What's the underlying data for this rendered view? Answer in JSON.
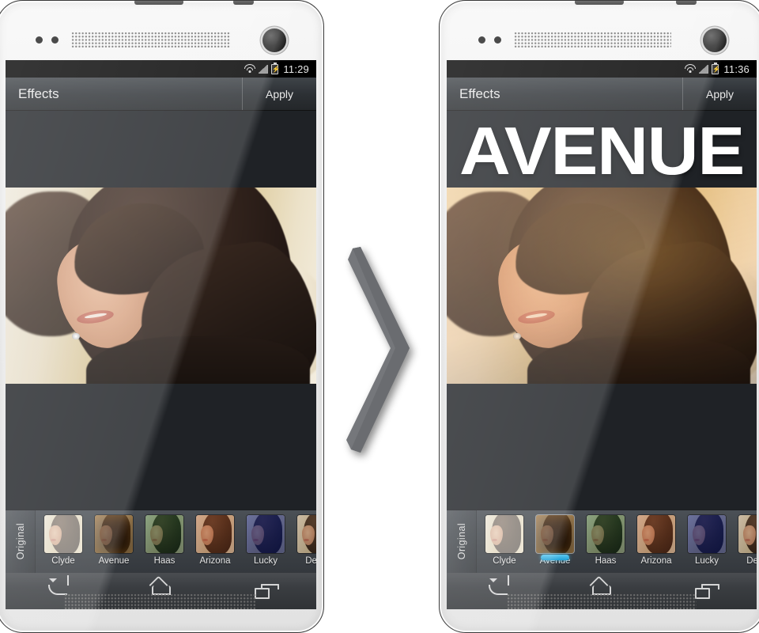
{
  "scene": {
    "description": "Before and after comparison of a photo-filter mobile app on two smartphones",
    "arrow_icon": "chevron-right-icon",
    "arrow_color": "#6f7175"
  },
  "phones": [
    {
      "id": "before",
      "status_bar": {
        "time": "11:29",
        "icons": [
          "wifi-icon",
          "signal-icon",
          "battery-charging-icon"
        ]
      },
      "action_bar": {
        "title": "Effects",
        "apply_label": "Apply"
      },
      "filter_title": "",
      "filmstrip": {
        "original_label": "Original",
        "selected": null,
        "filters": [
          {
            "name": "Clyde",
            "grade": "g-clyde"
          },
          {
            "name": "Avenue",
            "grade": "g-avenue"
          },
          {
            "name": "Haas",
            "grade": "g-haas"
          },
          {
            "name": "Arizona",
            "grade": "g-arizona"
          },
          {
            "name": "Lucky",
            "grade": "g-lucky"
          },
          {
            "name": "Dean",
            "grade": "g-dean"
          }
        ]
      },
      "nav_bar": {
        "back": "back-icon",
        "home": "home-icon",
        "recents": "recents-icon"
      }
    },
    {
      "id": "after",
      "status_bar": {
        "time": "11:36",
        "icons": [
          "wifi-icon",
          "signal-icon",
          "battery-charging-icon"
        ]
      },
      "action_bar": {
        "title": "Effects",
        "apply_label": "Apply"
      },
      "filter_title": "AVENUE",
      "filmstrip": {
        "original_label": "Original",
        "selected": "Avenue",
        "selection_color": "#33b5e5",
        "filters": [
          {
            "name": "Clyde",
            "grade": "g-clyde"
          },
          {
            "name": "Avenue",
            "grade": "g-avenue"
          },
          {
            "name": "Haas",
            "grade": "g-haas"
          },
          {
            "name": "Arizona",
            "grade": "g-arizona"
          },
          {
            "name": "Lucky",
            "grade": "g-lucky"
          },
          {
            "name": "Dean",
            "grade": "g-dean"
          }
        ]
      },
      "nav_bar": {
        "back": "back-icon",
        "home": "home-icon",
        "recents": "recents-icon"
      }
    }
  ],
  "colors": {
    "action_bar": "#2c3034",
    "filmstrip": "#3d4247",
    "screen_bg": "#1f2226",
    "accent_blue": "#33b5e5",
    "device_body": "#ededed"
  }
}
